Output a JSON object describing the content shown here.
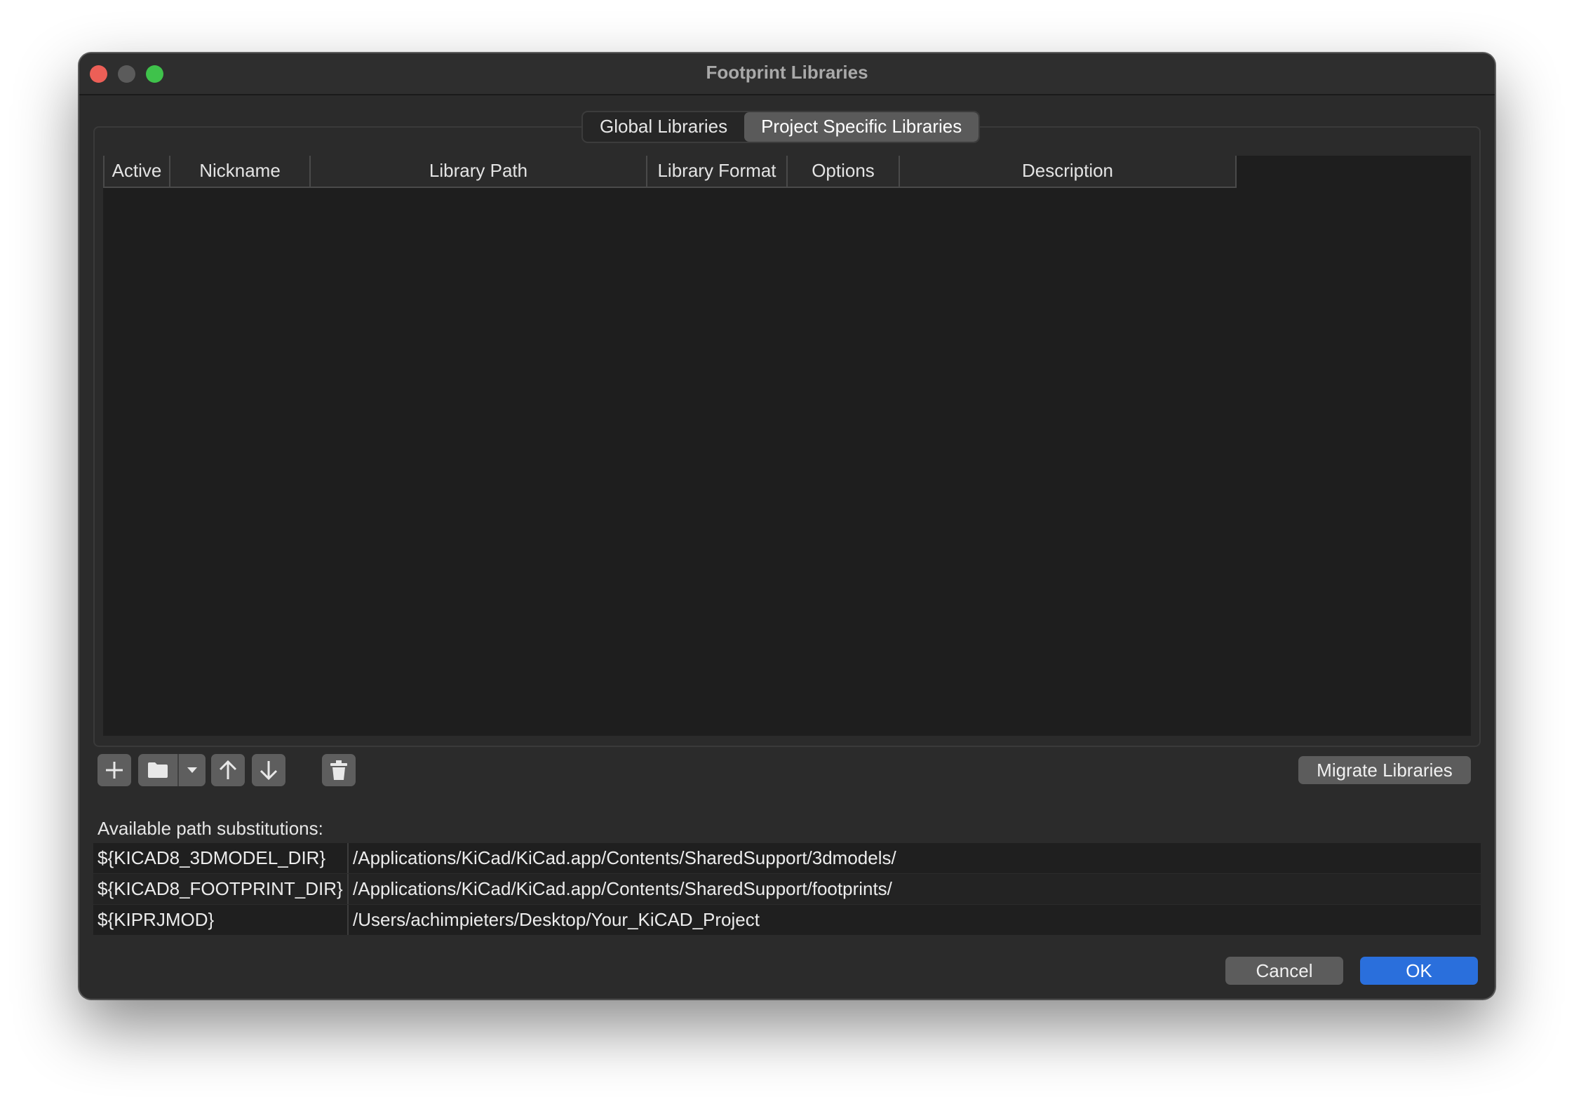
{
  "window": {
    "title": "Footprint Libraries"
  },
  "tabs": [
    {
      "label": "Global Libraries",
      "selected": false
    },
    {
      "label": "Project Specific Libraries",
      "selected": true
    }
  ],
  "grid": {
    "columns": [
      "Active",
      "Nickname",
      "Library Path",
      "Library Format",
      "Options",
      "Description"
    ],
    "rows": []
  },
  "toolbar": {
    "icons": [
      "plus-icon",
      "folder-icon",
      "chevron-down-icon",
      "arrow-up-icon",
      "arrow-down-icon",
      "trash-icon"
    ],
    "migrate_label": "Migrate Libraries"
  },
  "substitutions": {
    "label": "Available path substitutions:",
    "rows": [
      {
        "key": "${KICAD8_3DMODEL_DIR}",
        "value": "/Applications/KiCad/KiCad.app/Contents/SharedSupport/3dmodels/"
      },
      {
        "key": "${KICAD8_FOOTPRINT_DIR}",
        "value": "/Applications/KiCad/KiCad.app/Contents/SharedSupport/footprints/"
      },
      {
        "key": "${KIPRJMOD}",
        "value": "/Users/achimpieters/Desktop/Your_KiCAD_Project"
      }
    ]
  },
  "footer": {
    "cancel_label": "Cancel",
    "ok_label": "OK"
  },
  "colors": {
    "accent": "#2a6fdc",
    "window_bg": "#2b2b2b",
    "grid_bg": "#1e1e1e",
    "close": "#ec5f57",
    "maximize": "#3fc24b"
  }
}
